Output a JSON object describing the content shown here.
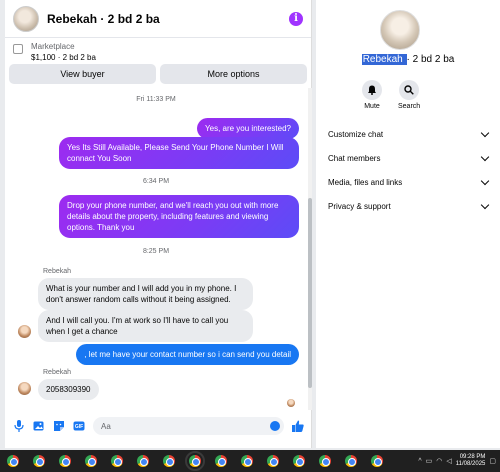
{
  "chat": {
    "title": "Rebekah · 2 bd 2 ba",
    "marketplace": {
      "label": "Marketplace",
      "price": "$1,100 · 2 bd 2 ba"
    },
    "buttons": {
      "view_buyer": "View buyer",
      "more_options": "More options"
    },
    "messages": {
      "ts1": "Fri 11:33 PM",
      "m1": "Yes, are you interested?",
      "m2": "Yes Its Still Available, Please Send Your Phone Number I Will connact You Soon",
      "ts2": "6:34 PM",
      "m3": "Drop your phone number, and we'll reach you out with more details about the property, including features and viewing options.  Thank you",
      "ts3": "8:25 PM",
      "sender1": "Rebekah",
      "m4": "What is your number and I will add you in my phone. I don't answer random calls without it being assigned.",
      "m5": "And I will call you. I'm at work so I'll have to call you when I get a chance",
      "m6": ", let me have your contact number so i can send you detail",
      "sender2": "Rebekah",
      "m7": "2058309390"
    },
    "composer": {
      "placeholder": "Aa"
    }
  },
  "side": {
    "name_selected": "Rebekah ",
    "name_rest": "· 2 bd 2 ba",
    "actions": {
      "mute": "Mute",
      "search": "Search"
    },
    "items": [
      "Customize chat",
      "Chat members",
      "Media, files and links",
      "Privacy & support"
    ]
  },
  "taskbar": {
    "app_icons": [
      "chrome-icon",
      "chrome-icon",
      "chrome-icon",
      "chrome-icon",
      "chrome-icon",
      "chrome-icon",
      "chrome-icon",
      "chrome-icon",
      "chrome-icon",
      "chrome-icon",
      "chrome-icon",
      "chrome-icon",
      "chrome-icon",
      "chrome-icon",
      "chrome-icon"
    ],
    "time": "09:28 PM",
    "date": "11/08/2025"
  },
  "colors": {
    "accent_purple": "#a033ff",
    "messenger_blue": "#1877f2",
    "selection": "#3367d6"
  }
}
